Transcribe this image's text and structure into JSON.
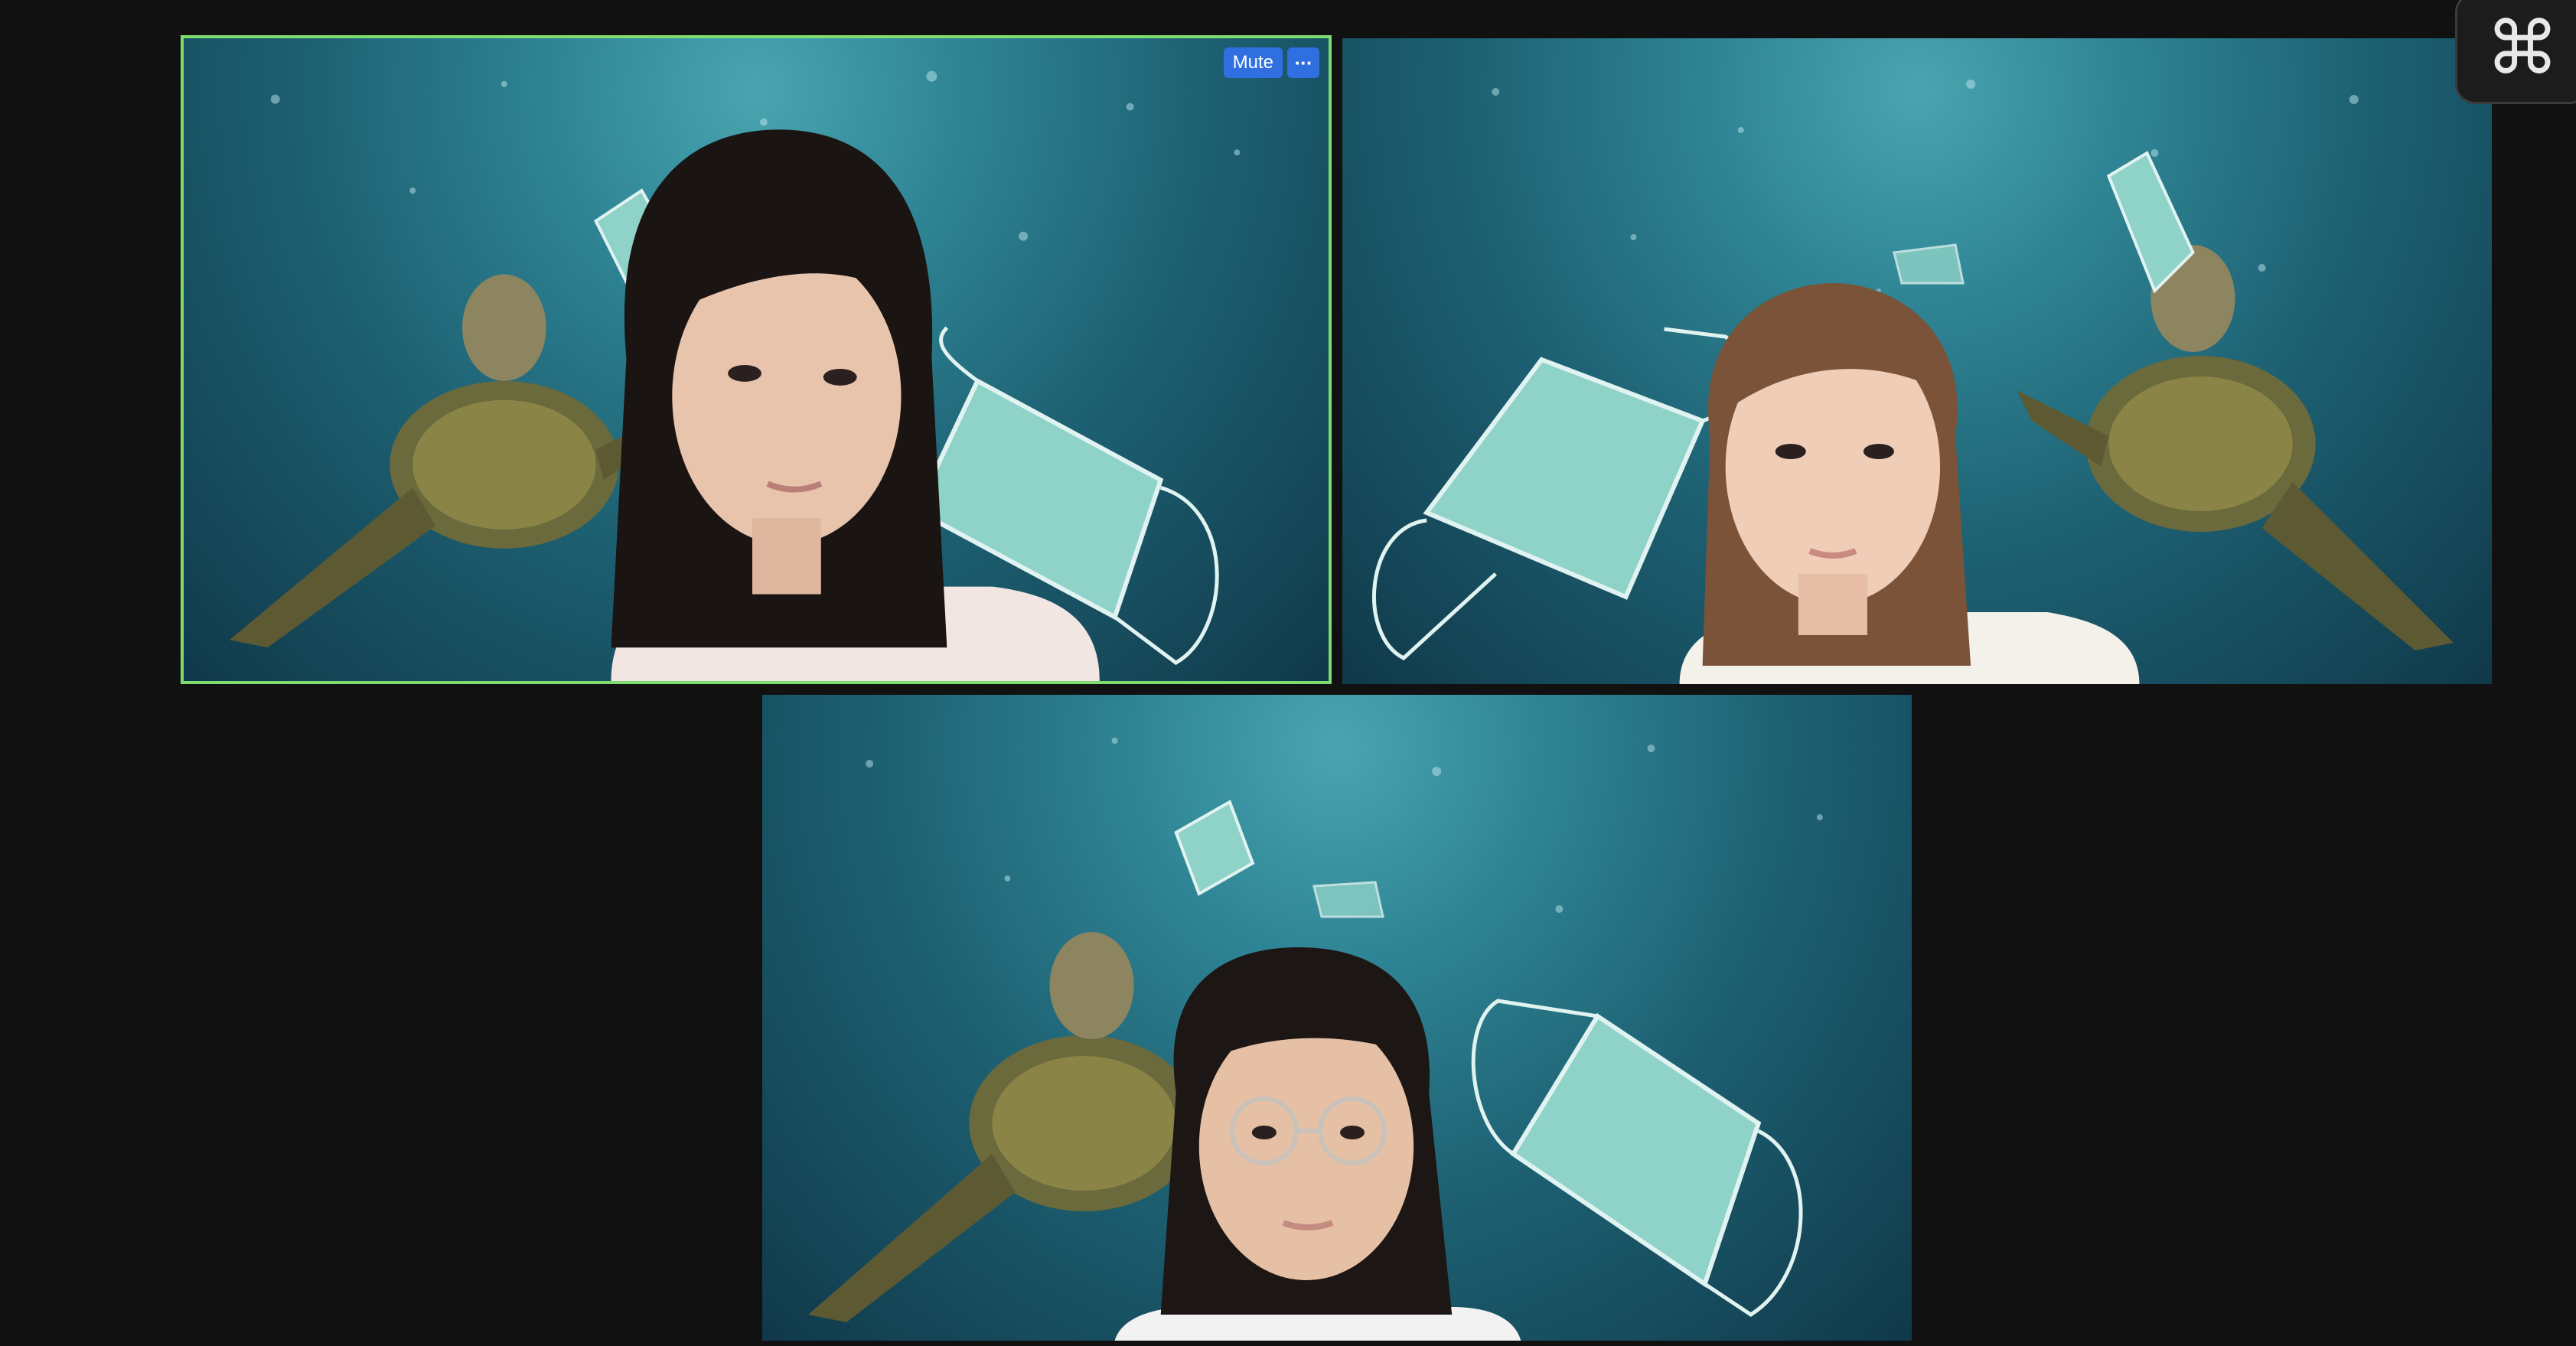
{
  "participants": [
    {
      "id": "participant-1",
      "active_speaker": true,
      "hair": "#1a1412",
      "skin": "#e9c4ac",
      "shirt": "#f1e6e2"
    },
    {
      "id": "participant-2",
      "active_speaker": false,
      "hair": "#7a5338",
      "skin": "#f0cdb6",
      "shirt": "#f4f0ea"
    },
    {
      "id": "participant-3",
      "active_speaker": false,
      "hair": "#1c1614",
      "skin": "#e6c0a4",
      "shirt": "#f2f2f2"
    }
  ],
  "hover_controls": {
    "mute_label": "Mute",
    "more_label": "···"
  },
  "shortcut_badge": {
    "symbol": "⌘",
    "icon": "command-key-icon"
  },
  "colors": {
    "background": "#111111",
    "active_speaker_border": "#7fdc6e",
    "button_blue": "#2f6fe0",
    "water": "#1d6173"
  }
}
